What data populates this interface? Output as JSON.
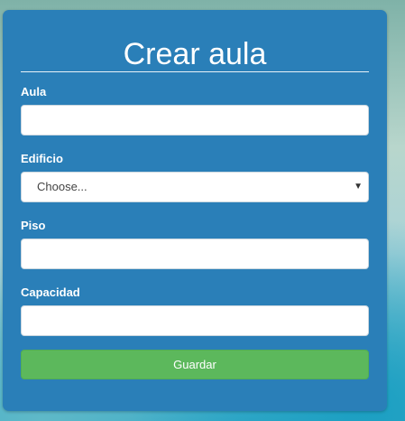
{
  "form": {
    "title": "Crear aula",
    "fields": {
      "aula": {
        "label": "Aula",
        "value": ""
      },
      "edificio": {
        "label": "Edificio",
        "selected": "Choose..."
      },
      "piso": {
        "label": "Piso",
        "value": ""
      },
      "capacidad": {
        "label": "Capacidad",
        "value": ""
      }
    },
    "submit_label": "Guardar",
    "colors": {
      "card": "#2a7fb8",
      "submit": "#5cb85c",
      "text": "#ffffff"
    }
  }
}
